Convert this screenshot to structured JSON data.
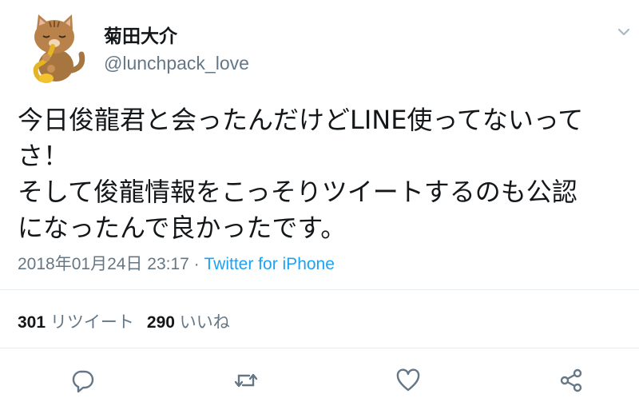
{
  "user": {
    "display_name": "菊田大介",
    "handle": "@lunchpack_love",
    "avatar_icon": "cat-playing-saxophone-icon"
  },
  "tweet": {
    "text": "今日俊龍君と会ったんだけどLINE使ってないって\nさ！\nそして俊龍情報をこっそりツイートするのも公認\nになったんで良かったです。",
    "timestamp": "2018年01月24日 23:17",
    "separator": " · ",
    "source": "Twitter for iPhone"
  },
  "stats": {
    "retweet_count": "301",
    "retweet_label": "リツイート",
    "like_count": "290",
    "like_label": "いいね"
  },
  "actions": {
    "reply_icon": "reply-icon",
    "retweet_icon": "retweet-icon",
    "like_icon": "heart-icon",
    "share_icon": "share-icon"
  },
  "colors": {
    "text": "#14171a",
    "secondary": "#657786",
    "link": "#1da1f2",
    "divider": "#e6ecf0"
  }
}
